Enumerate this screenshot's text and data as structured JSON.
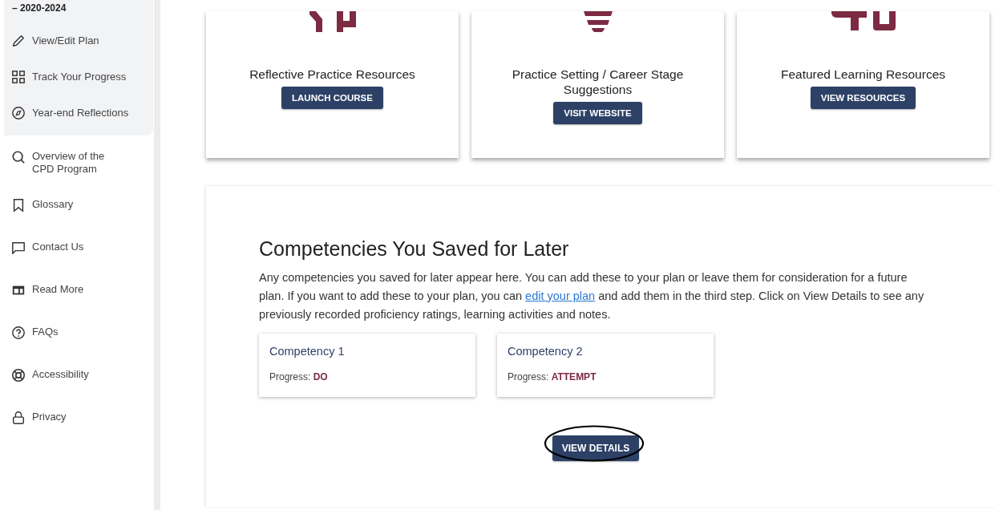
{
  "sidebar": {
    "period": "– 2020-2024",
    "plan_items": [
      {
        "label": "View/Edit Plan",
        "kind": "pencil"
      },
      {
        "label": "Track Your Progress",
        "kind": "grid"
      },
      {
        "label": "Year-end Reflections",
        "kind": "compass"
      }
    ],
    "items": [
      {
        "label": "Overview of the CPD Program",
        "kind": "search"
      },
      {
        "label": "Glossary",
        "kind": "bookmark"
      },
      {
        "label": "Contact Us",
        "kind": "chat"
      },
      {
        "label": "Read More",
        "kind": "article"
      },
      {
        "label": "FAQs",
        "kind": "help"
      },
      {
        "label": "Accessibility",
        "kind": "lifebuoy"
      },
      {
        "label": "Privacy",
        "kind": "lock"
      }
    ]
  },
  "resources": [
    {
      "title": "Reflective Practice Resources",
      "button": "LAUNCH COURSE",
      "kind": "pipes"
    },
    {
      "title": "Practice Setting / Career Stage Suggestions",
      "button": "VISIT WEBSITE",
      "kind": "bulb"
    },
    {
      "title": "Featured Learning Resources",
      "button": "VIEW RESOURCES",
      "kind": "blocks"
    }
  ],
  "saved": {
    "heading": "Competencies You Saved for Later",
    "text_before": "Any competencies you saved for later appear here. You can add these to your plan or leave them for consideration for a future plan. If you want to add these to your plan, you can ",
    "link": "edit your plan",
    "text_after": " and add them in the third step. Click on View Details to see any previously recorded proficiency ratings, learning activities and notes.",
    "competencies": [
      {
        "title": "Competency 1",
        "progress_label": "Progress:",
        "progress": "DO"
      },
      {
        "title": "Competency 2",
        "progress_label": "Progress:",
        "progress": "ATTEMPT"
      }
    ],
    "view_details": {
      "label": "VIEW DETAILS",
      "circled": true
    }
  }
}
